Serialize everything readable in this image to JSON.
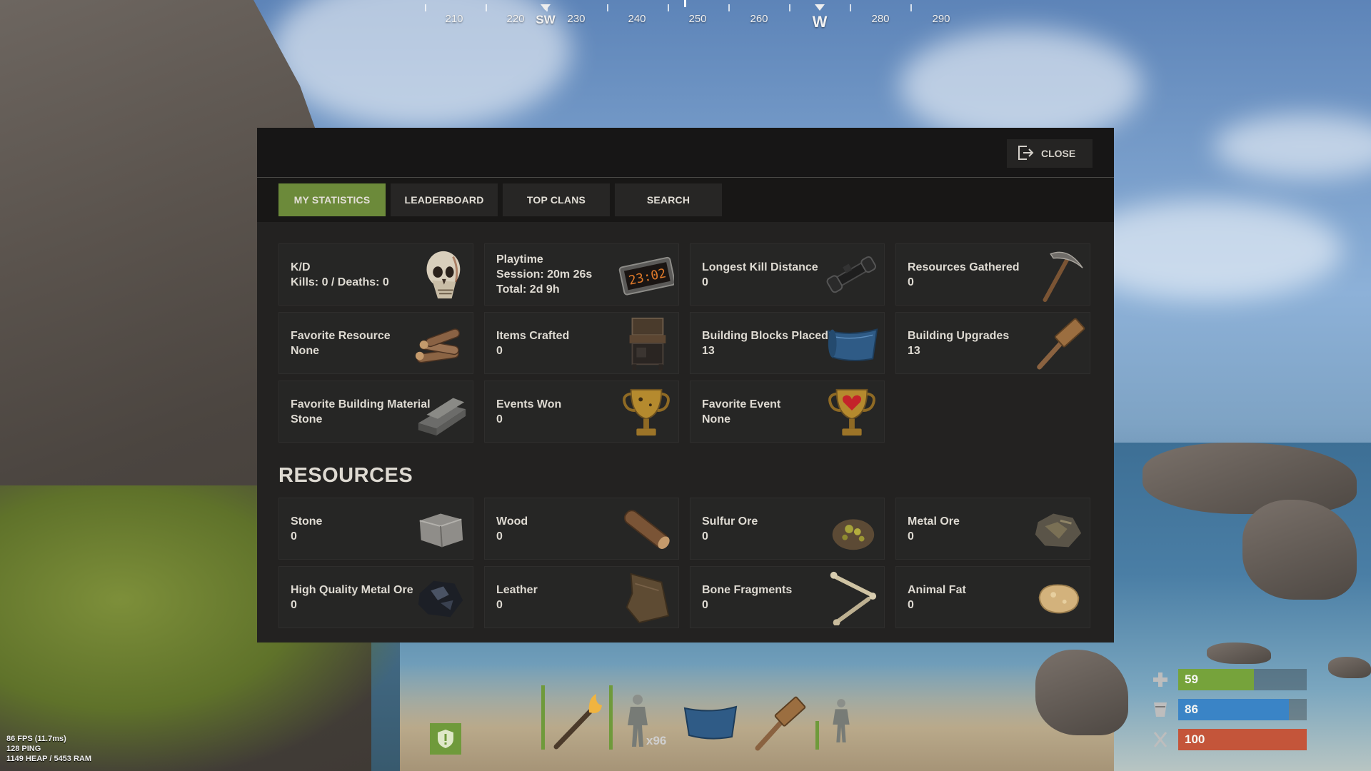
{
  "compass": {
    "labels": [
      {
        "text": "210",
        "cardinal": false
      },
      {
        "text": "220",
        "cardinal": false
      },
      {
        "text": "SW",
        "cardinal": true
      },
      {
        "text": "230",
        "cardinal": false
      },
      {
        "text": "240",
        "cardinal": false
      },
      {
        "text": "250",
        "cardinal": false
      },
      {
        "text": "260",
        "cardinal": false
      },
      {
        "text": "W",
        "cardinal": true
      },
      {
        "text": "280",
        "cardinal": false
      },
      {
        "text": "290",
        "cardinal": false
      }
    ]
  },
  "panel": {
    "close_label": "CLOSE",
    "tabs": [
      {
        "label": "MY STATISTICS",
        "active": true
      },
      {
        "label": "LEADERBOARD",
        "active": false
      },
      {
        "label": "TOP CLANS",
        "active": false
      },
      {
        "label": "SEARCH",
        "active": false
      }
    ],
    "stats": [
      {
        "title": "K/D",
        "lines": [
          "Kills: 0 / Deaths: 0"
        ],
        "icon": "skull-icon"
      },
      {
        "title": "Playtime",
        "lines": [
          "Session: 20m 26s",
          "Total: 2d 9h"
        ],
        "icon": "digital-clock-icon",
        "clock_text": "23:02"
      },
      {
        "title": "Longest Kill Distance",
        "lines": [
          "0"
        ],
        "icon": "scope-icon"
      },
      {
        "title": "Resources Gathered",
        "lines": [
          "0"
        ],
        "icon": "pickaxe-icon"
      },
      {
        "title": "Favorite Resource",
        "lines": [
          "None"
        ],
        "icon": "wood-pile-icon"
      },
      {
        "title": "Items Crafted",
        "lines": [
          "0"
        ],
        "icon": "workbench-icon"
      },
      {
        "title": "Building Blocks Placed",
        "lines": [
          "13"
        ],
        "icon": "building-plan-icon"
      },
      {
        "title": "Building Upgrades",
        "lines": [
          "13"
        ],
        "icon": "hammer-icon"
      },
      {
        "title": "Favorite Building Material",
        "lines": [
          "Stone"
        ],
        "icon": "stone-slab-icon"
      },
      {
        "title": "Events Won",
        "lines": [
          "0"
        ],
        "icon": "trophy-icon"
      },
      {
        "title": "Favorite Event",
        "lines": [
          "None"
        ],
        "icon": "heart-trophy-icon"
      }
    ],
    "resources_title": "RESOURCES",
    "resources": [
      {
        "title": "Stone",
        "value": "0",
        "icon": "stone-icon"
      },
      {
        "title": "Wood",
        "value": "0",
        "icon": "wood-log-icon"
      },
      {
        "title": "Sulfur Ore",
        "value": "0",
        "icon": "sulfur-ore-icon"
      },
      {
        "title": "Metal Ore",
        "value": "0",
        "icon": "metal-ore-icon"
      },
      {
        "title": "High Quality Metal Ore",
        "value": "0",
        "icon": "hq-metal-ore-icon"
      },
      {
        "title": "Leather",
        "value": "0",
        "icon": "leather-icon"
      },
      {
        "title": "Bone Fragments",
        "value": "0",
        "icon": "bone-icon"
      },
      {
        "title": "Animal Fat",
        "value": "0",
        "icon": "animal-fat-icon"
      }
    ]
  },
  "hud": {
    "debug": [
      "86 FPS (11.7ms)",
      "128 PING",
      "1149 HEAP / 5453 RAM"
    ],
    "hotbar_count": "x96",
    "health": {
      "value": "59",
      "fraction": 0.59,
      "color": "#76a33b"
    },
    "hydration": {
      "value": "86",
      "fraction": 0.86,
      "color": "#3a84c6"
    },
    "food": {
      "value": "100",
      "fraction": 1.0,
      "color": "#c4553a"
    }
  }
}
